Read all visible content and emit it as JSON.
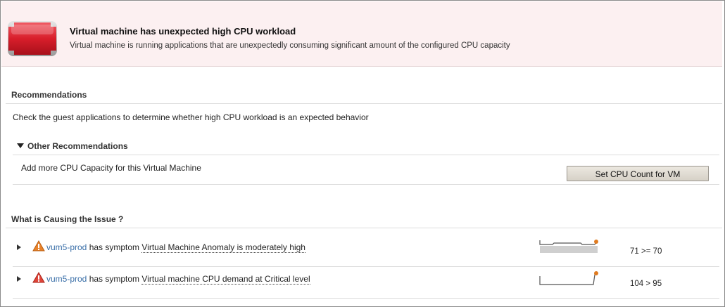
{
  "alert": {
    "title": "Virtual machine has unexpected high CPU workload",
    "description": "Virtual machine is running applications that are unexpectedly consuming significant amount of the configured CPU capacity",
    "severity_icon": "critical-badge-icon",
    "severity_color": "#cc1f2b"
  },
  "recommendations": {
    "section_title": "Recommendations",
    "primary": "Check the guest applications to determine whether high CPU workload is an expected behavior",
    "other_title": "Other Recommendations",
    "other_items": [
      {
        "text": "Add more CPU Capacity for this Virtual Machine",
        "action_label": "Set CPU Count for VM"
      }
    ]
  },
  "causes": {
    "section_title": "What is Causing the Issue ?",
    "items": [
      {
        "object": "vum5-prod",
        "verb": " has symptom ",
        "symptom": "Virtual Machine Anomaly is moderately high",
        "value_text": "71 >= 70",
        "icon": "warning-triangle-orange-icon",
        "icon_color": "#e07b20"
      },
      {
        "object": "vum5-prod",
        "verb": " has symptom ",
        "symptom": "Virtual machine CPU demand at Critical level",
        "value_text": "104 > 95",
        "icon": "warning-triangle-red-icon",
        "icon_color": "#d83a2a"
      }
    ]
  },
  "colors": {
    "accent_link": "#3a6fa8",
    "header_bg": "#fcf0f1",
    "sparkline_dot": "#e07b20"
  }
}
